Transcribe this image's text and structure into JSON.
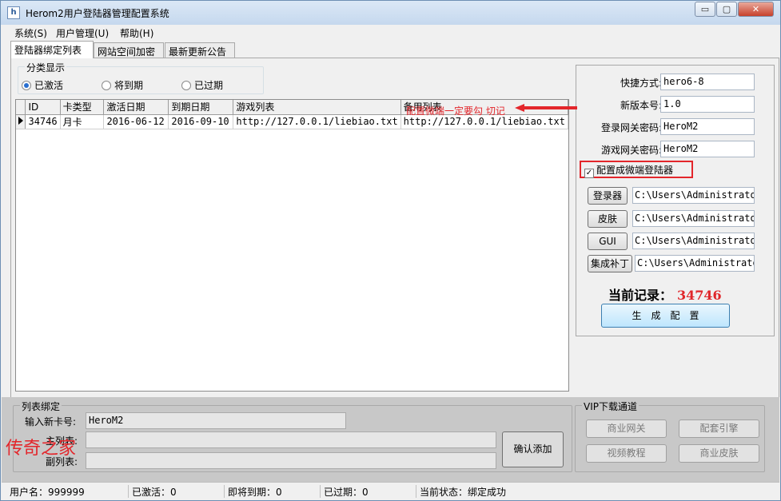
{
  "window": {
    "title": "Herom2用户登陆器管理配置系统",
    "app_icon": "h"
  },
  "window_controls": {
    "minimize": "▭",
    "maximize": "▢",
    "close": "✕"
  },
  "menu": [
    "系统(S)",
    "用户管理(U)",
    "帮助(H)"
  ],
  "tabs": [
    "登陆器绑定列表",
    "网站空间加密",
    "最新更新公告"
  ],
  "category": {
    "title": "分类显示",
    "options": [
      {
        "label": "已激活",
        "selected": true
      },
      {
        "label": "将到期",
        "selected": false
      },
      {
        "label": "已过期",
        "selected": false
      }
    ]
  },
  "table": {
    "columns": [
      "ID",
      "卡类型",
      "激活日期",
      "到期日期",
      "游戏列表",
      "备用列表"
    ],
    "rows": [
      [
        "34746",
        "月卡",
        "2016-06-12",
        "2016-09-10",
        "http://127.0.0.1/liebiao.txt",
        "http://127.0.0.1/liebiao.txt"
      ]
    ]
  },
  "config": {
    "shortcut_label": "快捷方式:",
    "shortcut_value": "hero6-8",
    "version_label": "新版本号:",
    "version_value": "1.0",
    "login_pwd_label": "登录网关密码:",
    "login_pwd_value": "HeroM2",
    "game_pwd_label": "游戏网关密码:",
    "game_pwd_value": "HeroM2",
    "checkbox_label": "配置成微端登陆器",
    "checkbox_checked": true,
    "path_buttons": [
      {
        "label": "登录器",
        "path": "C:\\Users\\Administrato"
      },
      {
        "label": "皮肤",
        "path": "C:\\Users\\Administrato"
      },
      {
        "label": "GUI",
        "path": "C:\\Users\\Administrato"
      },
      {
        "label": "集成补丁",
        "path": "C:\\Users\\Administrato"
      }
    ],
    "record_label": "当前记录：",
    "record_value": "34746",
    "generate_button": "生　成　配　置"
  },
  "annotation": "配置微端一定要勾 切记",
  "list_binding": {
    "title": "列表绑定",
    "card_label": "输入新卡号:",
    "card_value": "HeroM2",
    "main_list_label": "主列表:",
    "sub_list_label": "副列表:",
    "confirm_button": "确认添加"
  },
  "vip": {
    "title": "VIP下载通道",
    "buttons": [
      "商业网关",
      "配套引擎",
      "视频教程",
      "商业皮肤"
    ]
  },
  "watermark": "传奇之家",
  "status": {
    "user": "用户名：999999",
    "active": "已激活：0",
    "expiring": "即将到期：0",
    "expired": "已过期：0",
    "state": "当前状态：绑定成功"
  },
  "colors": {
    "accent_red": "#e3262b",
    "record_red": "#e0262a"
  }
}
